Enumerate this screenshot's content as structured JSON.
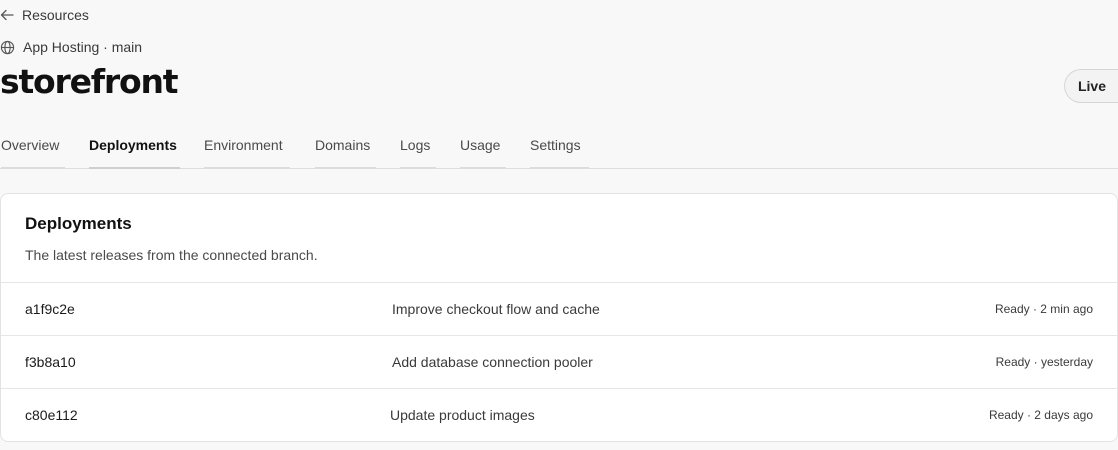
{
  "header": {
    "back_label": "Resources",
    "service_label": "App Hosting · main",
    "title": "storefront",
    "status": "Live"
  },
  "tabs": [
    {
      "label": "Overview",
      "active": false
    },
    {
      "label": "Deployments",
      "active": true
    },
    {
      "label": "Environment",
      "active": false
    },
    {
      "label": "Domains",
      "active": false
    },
    {
      "label": "Logs",
      "active": false
    },
    {
      "label": "Usage",
      "active": false
    },
    {
      "label": "Settings",
      "active": false
    }
  ],
  "deployments": {
    "title": "Deployments",
    "subtitle": "The latest releases from the connected branch.",
    "rows": [
      {
        "sha": "a1f9c2e",
        "message": "Improve checkout flow and cache",
        "status": "Ready · 2 min ago"
      },
      {
        "sha": "f3b8a10",
        "message": "Add database connection pooler",
        "status": "Ready · yesterday"
      },
      {
        "sha": "c80e112",
        "message": "Update product images",
        "status": "Ready · 2 days ago"
      }
    ]
  },
  "icons": {
    "back": "arrow-left-icon",
    "service": "globe-icon"
  }
}
